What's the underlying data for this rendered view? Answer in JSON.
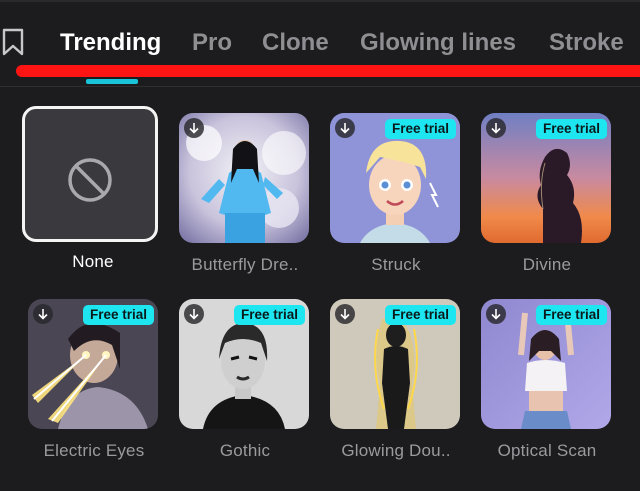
{
  "tabs": [
    {
      "label": "Trending",
      "active": true
    },
    {
      "label": "Pro",
      "active": false
    },
    {
      "label": "Clone",
      "active": false
    },
    {
      "label": "Glowing lines",
      "active": false
    },
    {
      "label": "Stroke",
      "active": false
    }
  ],
  "colors": {
    "accent": "#19c3d8",
    "badge": "#1ee6f0",
    "annotation": "#ff1414",
    "background": "#1c1c1e"
  },
  "effects": [
    {
      "name": "None",
      "selected": true,
      "badge": "",
      "icon": "no-entry-icon"
    },
    {
      "name": "Butterfly Dre..",
      "selected": false,
      "badge": ""
    },
    {
      "name": "Struck",
      "selected": false,
      "badge": "Free trial"
    },
    {
      "name": "Divine",
      "selected": false,
      "badge": "Free trial"
    },
    {
      "name": "Electric Eyes",
      "selected": false,
      "badge": "Free trial"
    },
    {
      "name": "Gothic",
      "selected": false,
      "badge": "Free trial"
    },
    {
      "name": "Glowing Dou..",
      "selected": false,
      "badge": "Free trial"
    },
    {
      "name": "Optical Scan",
      "selected": false,
      "badge": "Free trial"
    }
  ]
}
